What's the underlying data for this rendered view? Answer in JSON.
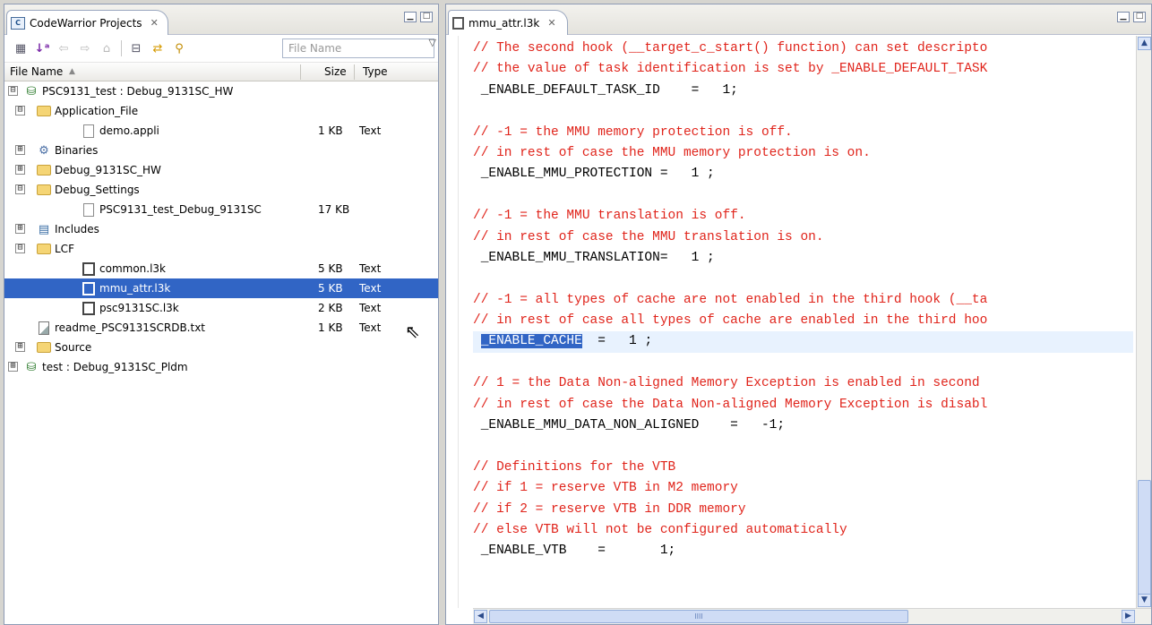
{
  "left_view": {
    "tab_label": "CodeWarrior Projects",
    "close_glyph": "✕",
    "filter_placeholder": "File Name",
    "columns": {
      "name": "File Name",
      "size": "Size",
      "type": "Type"
    },
    "rows": [
      {
        "level": 0,
        "expander": "⊟",
        "icon": "project-icon",
        "label": "PSC9131_test : Debug_9131SC_HW",
        "size": "",
        "type": ""
      },
      {
        "level": 1,
        "expander": "⊟",
        "icon": "folder-icon",
        "label": "Application_File",
        "size": "",
        "type": ""
      },
      {
        "level": 2,
        "expander": "",
        "icon": "file-icon",
        "label": "demo.appli",
        "size": "1 KB",
        "type": "Text"
      },
      {
        "level": 1,
        "expander": "⊞",
        "icon": "binaries-icon",
        "label": "Binaries",
        "size": "",
        "type": ""
      },
      {
        "level": 1,
        "expander": "⊞",
        "icon": "folder-icon",
        "label": "Debug_9131SC_HW",
        "size": "",
        "type": ""
      },
      {
        "level": 1,
        "expander": "⊟",
        "icon": "folder-icon",
        "label": "Debug_Settings",
        "size": "",
        "type": ""
      },
      {
        "level": 2,
        "expander": "",
        "icon": "file-icon",
        "label": "PSC9131_test_Debug_9131SC",
        "size": "17 KB",
        "type": ""
      },
      {
        "level": 1,
        "expander": "⊞",
        "icon": "includes-icon",
        "label": "Includes",
        "size": "",
        "type": ""
      },
      {
        "level": 1,
        "expander": "⊟",
        "icon": "folder-icon",
        "label": "LCF",
        "size": "",
        "type": ""
      },
      {
        "level": 2,
        "expander": "",
        "icon": "l3k-file-icon",
        "label": "common.l3k",
        "size": "5 KB",
        "type": "Text"
      },
      {
        "level": 2,
        "expander": "",
        "icon": "l3k-file-icon",
        "label": "mmu_attr.l3k",
        "size": "5 KB",
        "type": "Text",
        "selected": true
      },
      {
        "level": 2,
        "expander": "",
        "icon": "l3k-file-icon",
        "label": "psc9131SC.l3k",
        "size": "2 KB",
        "type": "Text"
      },
      {
        "level": 1,
        "expander": "",
        "icon": "text-file-icon",
        "label": "readme_PSC9131SCRDB.txt",
        "size": "1 KB",
        "type": "Text"
      },
      {
        "level": 1,
        "expander": "⊞",
        "icon": "folder-icon",
        "label": "Source",
        "size": "",
        "type": ""
      },
      {
        "level": 0,
        "expander": "⊞",
        "icon": "project-icon",
        "label": "test : Debug_9131SC_Pldm",
        "size": "",
        "type": ""
      }
    ]
  },
  "editor": {
    "tab_label": "mmu_attr.l3k",
    "close_glyph": "✕",
    "lines": [
      {
        "kind": "comment",
        "text": "// The second hook (__target_c_start() function) can set descripto"
      },
      {
        "kind": "comment",
        "text": "// the value of task identification is set by _ENABLE_DEFAULT_TASK"
      },
      {
        "kind": "code",
        "text": " _ENABLE_DEFAULT_TASK_ID    =   1;"
      },
      {
        "kind": "code",
        "text": ""
      },
      {
        "kind": "comment",
        "text": "// -1 = the MMU memory protection is off."
      },
      {
        "kind": "comment",
        "text": "// in rest of case the MMU memory protection is on."
      },
      {
        "kind": "code",
        "text": " _ENABLE_MMU_PROTECTION =   1 ;"
      },
      {
        "kind": "code",
        "text": ""
      },
      {
        "kind": "comment",
        "text": "// -1 = the MMU translation is off."
      },
      {
        "kind": "comment",
        "text": "// in rest of case the MMU translation is on."
      },
      {
        "kind": "code",
        "text": " _ENABLE_MMU_TRANSLATION=   1 ;"
      },
      {
        "kind": "code",
        "text": ""
      },
      {
        "kind": "comment",
        "text": "// -1 = all types of cache are not enabled in the third hook (__ta"
      },
      {
        "kind": "comment",
        "text": "// in rest of case all types of cache are enabled in the third hoo"
      },
      {
        "kind": "selected",
        "prefix": " ",
        "selection": "_ENABLE_CACHE",
        "rest": "  =   1 ;"
      },
      {
        "kind": "code",
        "text": ""
      },
      {
        "kind": "comment",
        "text": "// 1 = the Data Non-aligned Memory Exception is enabled in second"
      },
      {
        "kind": "comment",
        "text": "// in rest of case the Data Non-aligned Memory Exception is disabl"
      },
      {
        "kind": "code",
        "text": " _ENABLE_MMU_DATA_NON_ALIGNED    =   -1;"
      },
      {
        "kind": "code",
        "text": ""
      },
      {
        "kind": "comment",
        "text": "// Definitions for the VTB"
      },
      {
        "kind": "comment",
        "text": "// if 1 = reserve VTB in M2 memory"
      },
      {
        "kind": "comment",
        "text": "// if 2 = reserve VTB in DDR memory"
      },
      {
        "kind": "comment",
        "text": "// else VTB will not be configured automatically"
      },
      {
        "kind": "code",
        "text": " _ENABLE_VTB    =       1;"
      }
    ]
  },
  "colors": {
    "comment": "#e0241b",
    "selection": "#3165c5",
    "line_highlight": "#e8f2fe"
  }
}
